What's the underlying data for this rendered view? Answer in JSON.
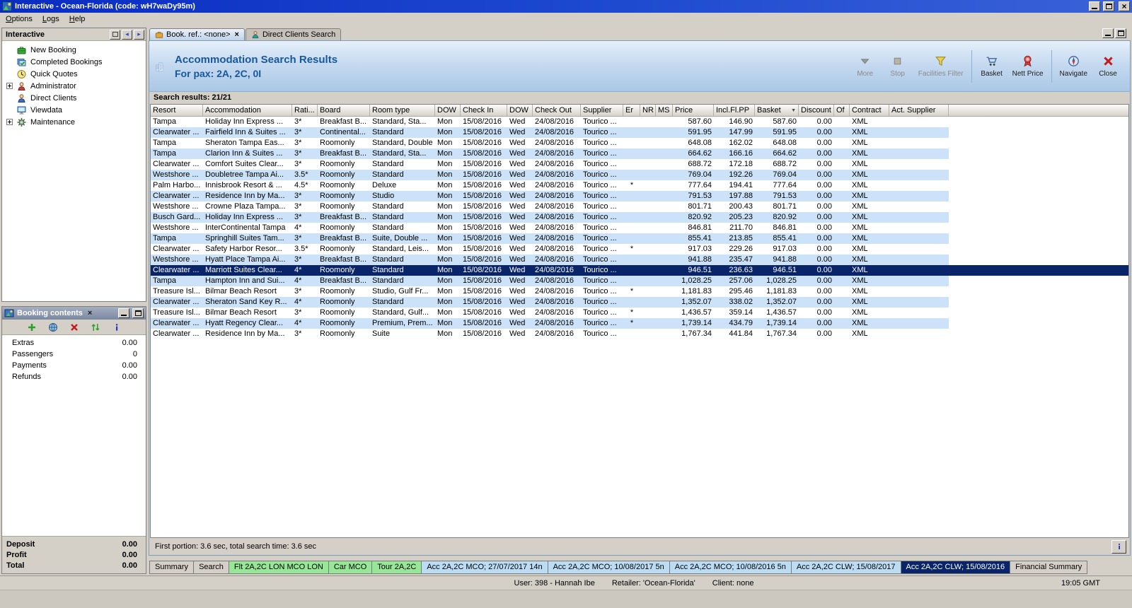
{
  "window": {
    "title": "Interactive - Ocean-Florida (code: wH7waDy95m)",
    "menu": [
      "Options",
      "Logs",
      "Help"
    ]
  },
  "sidebar": {
    "title": "Interactive",
    "items": [
      {
        "label": "New Booking",
        "icon": "new-booking-icon",
        "expandable": false
      },
      {
        "label": "Completed Bookings",
        "icon": "completed-bookings-icon",
        "expandable": false
      },
      {
        "label": "Quick Quotes",
        "icon": "quick-quotes-icon",
        "expandable": false
      },
      {
        "label": "Administrator",
        "icon": "administrator-icon",
        "expandable": true
      },
      {
        "label": "Direct Clients",
        "icon": "direct-clients-icon",
        "expandable": false
      },
      {
        "label": "Viewdata",
        "icon": "viewdata-icon",
        "expandable": false
      },
      {
        "label": "Maintenance",
        "icon": "maintenance-icon",
        "expandable": true
      }
    ]
  },
  "booking_contents": {
    "title": "Booking contents",
    "toolbar": [
      {
        "name": "add-icon"
      },
      {
        "name": "globe-icon"
      },
      {
        "name": "delete-icon"
      },
      {
        "name": "reorder-icon"
      },
      {
        "name": "info-icon"
      }
    ],
    "rows": [
      {
        "label": "Extras",
        "value": "0.00"
      },
      {
        "label": "Passengers",
        "value": "0"
      },
      {
        "label": "Payments",
        "value": "0.00"
      },
      {
        "label": "Refunds",
        "value": "0.00"
      }
    ],
    "totals": [
      {
        "label": "Deposit",
        "value": "0.00"
      },
      {
        "label": "Profit",
        "value": "0.00"
      },
      {
        "label": "Total",
        "value": "0.00"
      }
    ]
  },
  "doc_tabs": [
    {
      "label": "Book. ref.: <none>",
      "icon": "booking-tab-icon",
      "active": true,
      "closable": true
    },
    {
      "label": "Direct Clients Search",
      "icon": "clients-tab-icon",
      "active": false,
      "closable": false
    }
  ],
  "header": {
    "title": "Accommodation Search Results",
    "subtitle": "For pax: 2A, 2C, 0I",
    "toolbar": [
      {
        "label": "More",
        "icon": "more-icon",
        "enabled": false,
        "sep_before": false
      },
      {
        "label": "Stop",
        "icon": "stop-icon",
        "enabled": false,
        "sep_before": false
      },
      {
        "label": "Facilities Filter",
        "icon": "filter-icon",
        "enabled": false,
        "sep_before": false
      },
      {
        "label": "Basket",
        "icon": "basket-icon",
        "enabled": true,
        "sep_before": true
      },
      {
        "label": "Nett Price",
        "icon": "nett-price-icon",
        "enabled": true,
        "sep_before": false
      },
      {
        "label": "Navigate",
        "icon": "navigate-icon",
        "enabled": true,
        "sep_before": true
      },
      {
        "label": "Close",
        "icon": "close-red-icon",
        "enabled": true,
        "sep_before": false
      }
    ]
  },
  "results": {
    "summary": "Search results: 21/21",
    "sort_column": "Basket",
    "columns": [
      "Resort",
      "Accommodation",
      "Rati...",
      "Board",
      "Room type",
      "DOW",
      "Check In",
      "DOW",
      "Check Out",
      "Supplier",
      "Er",
      "NR",
      "MS",
      "Price",
      "Incl.Fl.PP",
      "Basket",
      "Discount",
      "Of",
      "Contract",
      "Act. Supplier"
    ],
    "selected_index": 14,
    "rows": [
      [
        "Tampa",
        "Holiday Inn Express ...",
        "3*",
        "Breakfast B...",
        "Standard, Sta...",
        "Mon",
        "15/08/2016",
        "Wed",
        "24/08/2016",
        "Tourico ...",
        "",
        "",
        "",
        "587.60",
        "146.90",
        "587.60",
        "0.00",
        "",
        "XML",
        ""
      ],
      [
        "Clearwater ...",
        "Fairfield Inn & Suites ...",
        "3*",
        "Continental...",
        "Standard",
        "Mon",
        "15/08/2016",
        "Wed",
        "24/08/2016",
        "Tourico ...",
        "",
        "",
        "",
        "591.95",
        "147.99",
        "591.95",
        "0.00",
        "",
        "XML",
        ""
      ],
      [
        "Tampa",
        "Sheraton Tampa Eas...",
        "3*",
        "Roomonly",
        "Standard, Double",
        "Mon",
        "15/08/2016",
        "Wed",
        "24/08/2016",
        "Tourico ...",
        "",
        "",
        "",
        "648.08",
        "162.02",
        "648.08",
        "0.00",
        "",
        "XML",
        ""
      ],
      [
        "Tampa",
        "Clarion Inn & Suites ...",
        "3*",
        "Breakfast B...",
        "Standard, Sta...",
        "Mon",
        "15/08/2016",
        "Wed",
        "24/08/2016",
        "Tourico ...",
        "",
        "",
        "",
        "664.62",
        "166.16",
        "664.62",
        "0.00",
        "",
        "XML",
        ""
      ],
      [
        "Clearwater ...",
        "Comfort Suites Clear...",
        "3*",
        "Roomonly",
        "Standard",
        "Mon",
        "15/08/2016",
        "Wed",
        "24/08/2016",
        "Tourico ...",
        "",
        "",
        "",
        "688.72",
        "172.18",
        "688.72",
        "0.00",
        "",
        "XML",
        ""
      ],
      [
        "Westshore ...",
        "Doubletree Tampa Ai...",
        "3.5*",
        "Roomonly",
        "Standard",
        "Mon",
        "15/08/2016",
        "Wed",
        "24/08/2016",
        "Tourico ...",
        "",
        "",
        "",
        "769.04",
        "192.26",
        "769.04",
        "0.00",
        "",
        "XML",
        ""
      ],
      [
        "Palm Harbo...",
        "Innisbrook Resort & ...",
        "4.5*",
        "Roomonly",
        "Deluxe",
        "Mon",
        "15/08/2016",
        "Wed",
        "24/08/2016",
        "Tourico ...",
        "*",
        "",
        "",
        "777.64",
        "194.41",
        "777.64",
        "0.00",
        "",
        "XML",
        ""
      ],
      [
        "Clearwater ...",
        "Residence Inn by Ma...",
        "3*",
        "Roomonly",
        "Studio",
        "Mon",
        "15/08/2016",
        "Wed",
        "24/08/2016",
        "Tourico ...",
        "",
        "",
        "",
        "791.53",
        "197.88",
        "791.53",
        "0.00",
        "",
        "XML",
        ""
      ],
      [
        "Westshore ...",
        "Crowne Plaza Tampa...",
        "3*",
        "Roomonly",
        "Standard",
        "Mon",
        "15/08/2016",
        "Wed",
        "24/08/2016",
        "Tourico ...",
        "",
        "",
        "",
        "801.71",
        "200.43",
        "801.71",
        "0.00",
        "",
        "XML",
        ""
      ],
      [
        "Busch Gard...",
        "Holiday Inn Express ...",
        "3*",
        "Breakfast B...",
        "Standard",
        "Mon",
        "15/08/2016",
        "Wed",
        "24/08/2016",
        "Tourico ...",
        "",
        "",
        "",
        "820.92",
        "205.23",
        "820.92",
        "0.00",
        "",
        "XML",
        ""
      ],
      [
        "Westshore ...",
        "InterContinental Tampa",
        "4*",
        "Roomonly",
        "Standard",
        "Mon",
        "15/08/2016",
        "Wed",
        "24/08/2016",
        "Tourico ...",
        "",
        "",
        "",
        "846.81",
        "211.70",
        "846.81",
        "0.00",
        "",
        "XML",
        ""
      ],
      [
        "Tampa",
        "Springhill Suites Tam...",
        "3*",
        "Breakfast B...",
        "Suite, Double ...",
        "Mon",
        "15/08/2016",
        "Wed",
        "24/08/2016",
        "Tourico ...",
        "",
        "",
        "",
        "855.41",
        "213.85",
        "855.41",
        "0.00",
        "",
        "XML",
        ""
      ],
      [
        "Clearwater ...",
        "Safety Harbor Resor...",
        "3.5*",
        "Roomonly",
        "Standard, Leis...",
        "Mon",
        "15/08/2016",
        "Wed",
        "24/08/2016",
        "Tourico ...",
        "*",
        "",
        "",
        "917.03",
        "229.26",
        "917.03",
        "0.00",
        "",
        "XML",
        ""
      ],
      [
        "Westshore ...",
        "Hyatt Place Tampa Ai...",
        "3*",
        "Breakfast B...",
        "Standard",
        "Mon",
        "15/08/2016",
        "Wed",
        "24/08/2016",
        "Tourico ...",
        "",
        "",
        "",
        "941.88",
        "235.47",
        "941.88",
        "0.00",
        "",
        "XML",
        ""
      ],
      [
        "Clearwater ...",
        "Marriott Suites Clear...",
        "4*",
        "Roomonly",
        "Standard",
        "Mon",
        "15/08/2016",
        "Wed",
        "24/08/2016",
        "Tourico ...",
        "",
        "",
        "",
        "946.51",
        "236.63",
        "946.51",
        "0.00",
        "",
        "XML",
        ""
      ],
      [
        "Tampa",
        "Hampton Inn and Sui...",
        "4*",
        "Breakfast B...",
        "Standard",
        "Mon",
        "15/08/2016",
        "Wed",
        "24/08/2016",
        "Tourico ...",
        "",
        "",
        "",
        "1,028.25",
        "257.06",
        "1,028.25",
        "0.00",
        "",
        "XML",
        ""
      ],
      [
        "Treasure Isl...",
        "Bilmar Beach Resort",
        "3*",
        "Roomonly",
        "Studio, Gulf Fr...",
        "Mon",
        "15/08/2016",
        "Wed",
        "24/08/2016",
        "Tourico ...",
        "*",
        "",
        "",
        "1,181.83",
        "295.46",
        "1,181.83",
        "0.00",
        "",
        "XML",
        ""
      ],
      [
        "Clearwater ...",
        "Sheraton Sand Key R...",
        "4*",
        "Roomonly",
        "Standard",
        "Mon",
        "15/08/2016",
        "Wed",
        "24/08/2016",
        "Tourico ...",
        "",
        "",
        "",
        "1,352.07",
        "338.02",
        "1,352.07",
        "0.00",
        "",
        "XML",
        ""
      ],
      [
        "Treasure Isl...",
        "Bilmar Beach Resort",
        "3*",
        "Roomonly",
        "Standard, Gulf...",
        "Mon",
        "15/08/2016",
        "Wed",
        "24/08/2016",
        "Tourico ...",
        "*",
        "",
        "",
        "1,436.57",
        "359.14",
        "1,436.57",
        "0.00",
        "",
        "XML",
        ""
      ],
      [
        "Clearwater ...",
        "Hyatt Regency Clear...",
        "4*",
        "Roomonly",
        "Premium, Prem...",
        "Mon",
        "15/08/2016",
        "Wed",
        "24/08/2016",
        "Tourico ...",
        "*",
        "",
        "",
        "1,739.14",
        "434.79",
        "1,739.14",
        "0.00",
        "",
        "XML",
        ""
      ],
      [
        "Clearwater ...",
        "Residence Inn by Ma...",
        "3*",
        "Roomonly",
        "Suite",
        "Mon",
        "15/08/2016",
        "Wed",
        "24/08/2016",
        "Tourico ...",
        "",
        "",
        "",
        "1,767.34",
        "441.84",
        "1,767.34",
        "0.00",
        "",
        "XML",
        ""
      ]
    ],
    "footer": "First portion: 3.6 sec, total search time: 3.6 sec"
  },
  "bottom_tabs": [
    {
      "label": "Summary",
      "style": "plain"
    },
    {
      "label": "Search",
      "style": "plain"
    },
    {
      "label": "Flt 2A,2C LON MCO LON",
      "style": "green"
    },
    {
      "label": "Car MCO",
      "style": "green"
    },
    {
      "label": "Tour 2A,2C",
      "style": "green"
    },
    {
      "label": "Acc 2A,2C MCO; 27/07/2017 14n",
      "style": "blue"
    },
    {
      "label": "Acc 2A,2C MCO; 10/08/2017 5n",
      "style": "blue"
    },
    {
      "label": "Acc 2A,2C MCO; 10/08/2016 5n",
      "style": "blue"
    },
    {
      "label": "Acc 2A,2C CLW; 15/08/2017",
      "style": "blue"
    },
    {
      "label": "Acc 2A,2C CLW; 15/08/2016",
      "style": "selected"
    },
    {
      "label": "Financial Summary",
      "style": "plain"
    }
  ],
  "statusbar": {
    "user": "User: 398 - Hannah Ibe",
    "retailer": "Retailer: 'Ocean-Florida'",
    "client": "Client: none",
    "time": "19:05 GMT"
  },
  "colors": {
    "titlebar_blue": "#0a2cc2",
    "selection_navy": "#0a246a",
    "row_stripe_blue": "#cbe2f8",
    "tab_green": "#98e698",
    "tab_blue": "#bcdcf4",
    "header_accent_blue": "#17579d",
    "window_gray": "#d4d0c8"
  }
}
